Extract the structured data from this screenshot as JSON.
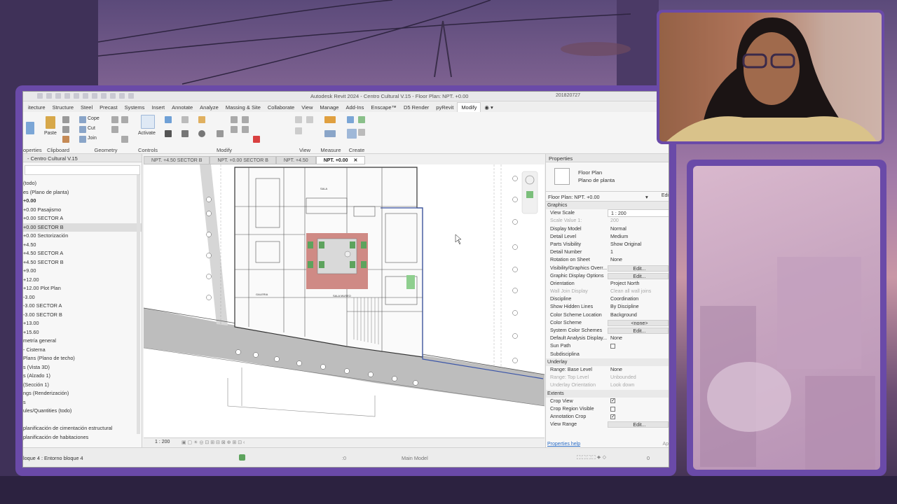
{
  "window": {
    "title": "Autodesk Revit 2024 - Centro Cultural V.15 - Floor Plan: NPT. +0.00",
    "user": "201820727"
  },
  "ribbon_tabs": [
    "itecture",
    "Structure",
    "Steel",
    "Precast",
    "Systems",
    "Insert",
    "Annotate",
    "Analyze",
    "Massing & Site",
    "Collaborate",
    "View",
    "Manage",
    "Add-Ins",
    "Enscape™",
    "D5 Render",
    "pyRevit",
    "Modify"
  ],
  "active_tab": "Modify",
  "ribbon": {
    "properties_label": "operties",
    "clipboard_label": "Clipboard",
    "paste_label": "Paste",
    "cope_label": "Cope",
    "cut_label": "Cut",
    "join_label": "Join",
    "geometry_label": "Geometry",
    "activate_label": "Activate",
    "controls_label": "Controls",
    "modify_label": "Modify",
    "view_label": "View",
    "measure_label": "Measure",
    "create_label": "Create"
  },
  "project_browser": {
    "title": "- Centro Cultural V.15",
    "items": [
      {
        "label": "(todo)",
        "sel": false,
        "bold": false
      },
      {
        "label": "es (Plano de planta)",
        "sel": false,
        "bold": false
      },
      {
        "label": "+0.00",
        "sel": false,
        "bold": true
      },
      {
        "label": "+0.00 Pasajismo",
        "sel": false,
        "bold": false
      },
      {
        "label": "+0.00 SECTOR A",
        "sel": false,
        "bold": false
      },
      {
        "label": "+0.00 SECTOR B",
        "sel": true,
        "bold": false
      },
      {
        "label": "+0.00 Sectorización",
        "sel": false,
        "bold": false
      },
      {
        "label": "+4.50",
        "sel": false,
        "bold": false
      },
      {
        "label": "+4.50 SECTOR A",
        "sel": false,
        "bold": false
      },
      {
        "label": "+4.50 SECTOR B",
        "sel": false,
        "bold": false
      },
      {
        "label": "+9.00",
        "sel": false,
        "bold": false
      },
      {
        "label": "+12.00",
        "sel": false,
        "bold": false
      },
      {
        "label": "+12.00 Plot Plan",
        "sel": false,
        "bold": false
      },
      {
        "label": "-3.00",
        "sel": false,
        "bold": false
      },
      {
        "label": "-3.00 SECTOR A",
        "sel": false,
        "bold": false
      },
      {
        "label": "-3.00 SECTOR B",
        "sel": false,
        "bold": false
      },
      {
        "label": "+13.00",
        "sel": false,
        "bold": false
      },
      {
        "label": "+15.60",
        "sel": false,
        "bold": false
      },
      {
        "label": "metría general",
        "sel": false,
        "bold": false
      },
      {
        "label": "- Cisterna",
        "sel": false,
        "bold": false
      },
      {
        "label": "Plans (Plano de techo)",
        "sel": false,
        "bold": false
      },
      {
        "label": "s (Vista 3D)",
        "sel": false,
        "bold": false
      },
      {
        "label": "s (Alzado 1)",
        "sel": false,
        "bold": false
      },
      {
        "label": "(Sección 1)",
        "sel": false,
        "bold": false
      },
      {
        "label": "ngs (Renderización)",
        "sel": false,
        "bold": false
      },
      {
        "label": "s",
        "sel": false,
        "bold": false
      },
      {
        "label": "ules/Quantities (todo)",
        "sel": false,
        "bold": false
      },
      {
        "label": "",
        "sel": false,
        "bold": false
      },
      {
        "label": "planificación de cimentación estructural",
        "sel": false,
        "bold": false
      },
      {
        "label": "planificación de habitaciones",
        "sel": false,
        "bold": false
      }
    ]
  },
  "view_tabs": [
    {
      "label": "NPT. +4.50 SECTOR B",
      "active": false
    },
    {
      "label": "NPT. +0.00 SECTOR B",
      "active": false
    },
    {
      "label": "NPT. +4.50",
      "active": false
    },
    {
      "label": "NPT. +0.00",
      "active": true
    }
  ],
  "view_close": "✕",
  "view_scale": "1 : 200",
  "plan_labels": {
    "room1": "GALERIA",
    "room2": "SALA MUSEO"
  },
  "properties": {
    "title": "Properties",
    "type_name": "Floor Plan",
    "type_sub": "Plano de planta",
    "selector": "Floor Plan: NPT. +0.00",
    "edit_type": "Edi",
    "rows": [
      {
        "k": "Graphics",
        "v": "",
        "kind": "cat"
      },
      {
        "k": "View Scale",
        "v": "1 : 200",
        "kind": "input"
      },
      {
        "k": "Scale Value   1:",
        "v": "200",
        "kind": "dim"
      },
      {
        "k": "Display Model",
        "v": "Normal",
        "kind": "row"
      },
      {
        "k": "Detail Level",
        "v": "Medium",
        "kind": "row"
      },
      {
        "k": "Parts Visibility",
        "v": "Show Original",
        "kind": "row"
      },
      {
        "k": "Detail Number",
        "v": "1",
        "kind": "row"
      },
      {
        "k": "Rotation on Sheet",
        "v": "None",
        "kind": "row"
      },
      {
        "k": "Visibility/Graphics Overr...",
        "v": "Edit...",
        "kind": "btn"
      },
      {
        "k": "Graphic Display Options",
        "v": "Edit...",
        "kind": "btn"
      },
      {
        "k": "Orientation",
        "v": "Project North",
        "kind": "row"
      },
      {
        "k": "Wall Join Display",
        "v": "Clean all wall joins",
        "kind": "dim"
      },
      {
        "k": "Discipline",
        "v": "Coordination",
        "kind": "row"
      },
      {
        "k": "Show Hidden Lines",
        "v": "By Discipline",
        "kind": "row"
      },
      {
        "k": "Color Scheme Location",
        "v": "Background",
        "kind": "row"
      },
      {
        "k": "Color Scheme",
        "v": "<none>",
        "kind": "btn"
      },
      {
        "k": "System Color Schemes",
        "v": "Edit...",
        "kind": "btn"
      },
      {
        "k": "Default Analysis Display...",
        "v": "None",
        "kind": "row"
      },
      {
        "k": "Sun Path",
        "v": "",
        "kind": "chk"
      },
      {
        "k": "Subdisciplina",
        "v": "",
        "kind": "row"
      },
      {
        "k": "Underlay",
        "v": "",
        "kind": "cat"
      },
      {
        "k": "Range: Base Level",
        "v": "None",
        "kind": "row"
      },
      {
        "k": "Range: Top Level",
        "v": "Unbounded",
        "kind": "dim"
      },
      {
        "k": "Underlay Orientation",
        "v": "Look down",
        "kind": "dim"
      },
      {
        "k": "Extents",
        "v": "",
        "kind": "cat"
      },
      {
        "k": "Crop View",
        "v": "",
        "kind": "chkon"
      },
      {
        "k": "Crop Region Visible",
        "v": "",
        "kind": "chk"
      },
      {
        "k": "Annotation Crop",
        "v": "",
        "kind": "chkon"
      },
      {
        "k": "View Range",
        "v": "Edit...",
        "kind": "btn"
      }
    ],
    "help": "Properties help",
    "apply": "Ap"
  },
  "status": {
    "left": "loque 4 : Entorno bloque 4",
    "model": "Main Model",
    "zero": ":0",
    "filter": "0"
  },
  "colors": {
    "frame": "#6a4aa8",
    "plan_red": "#cf8a85",
    "plan_green": "#5da35d",
    "plan_blue": "#3b55a8"
  }
}
